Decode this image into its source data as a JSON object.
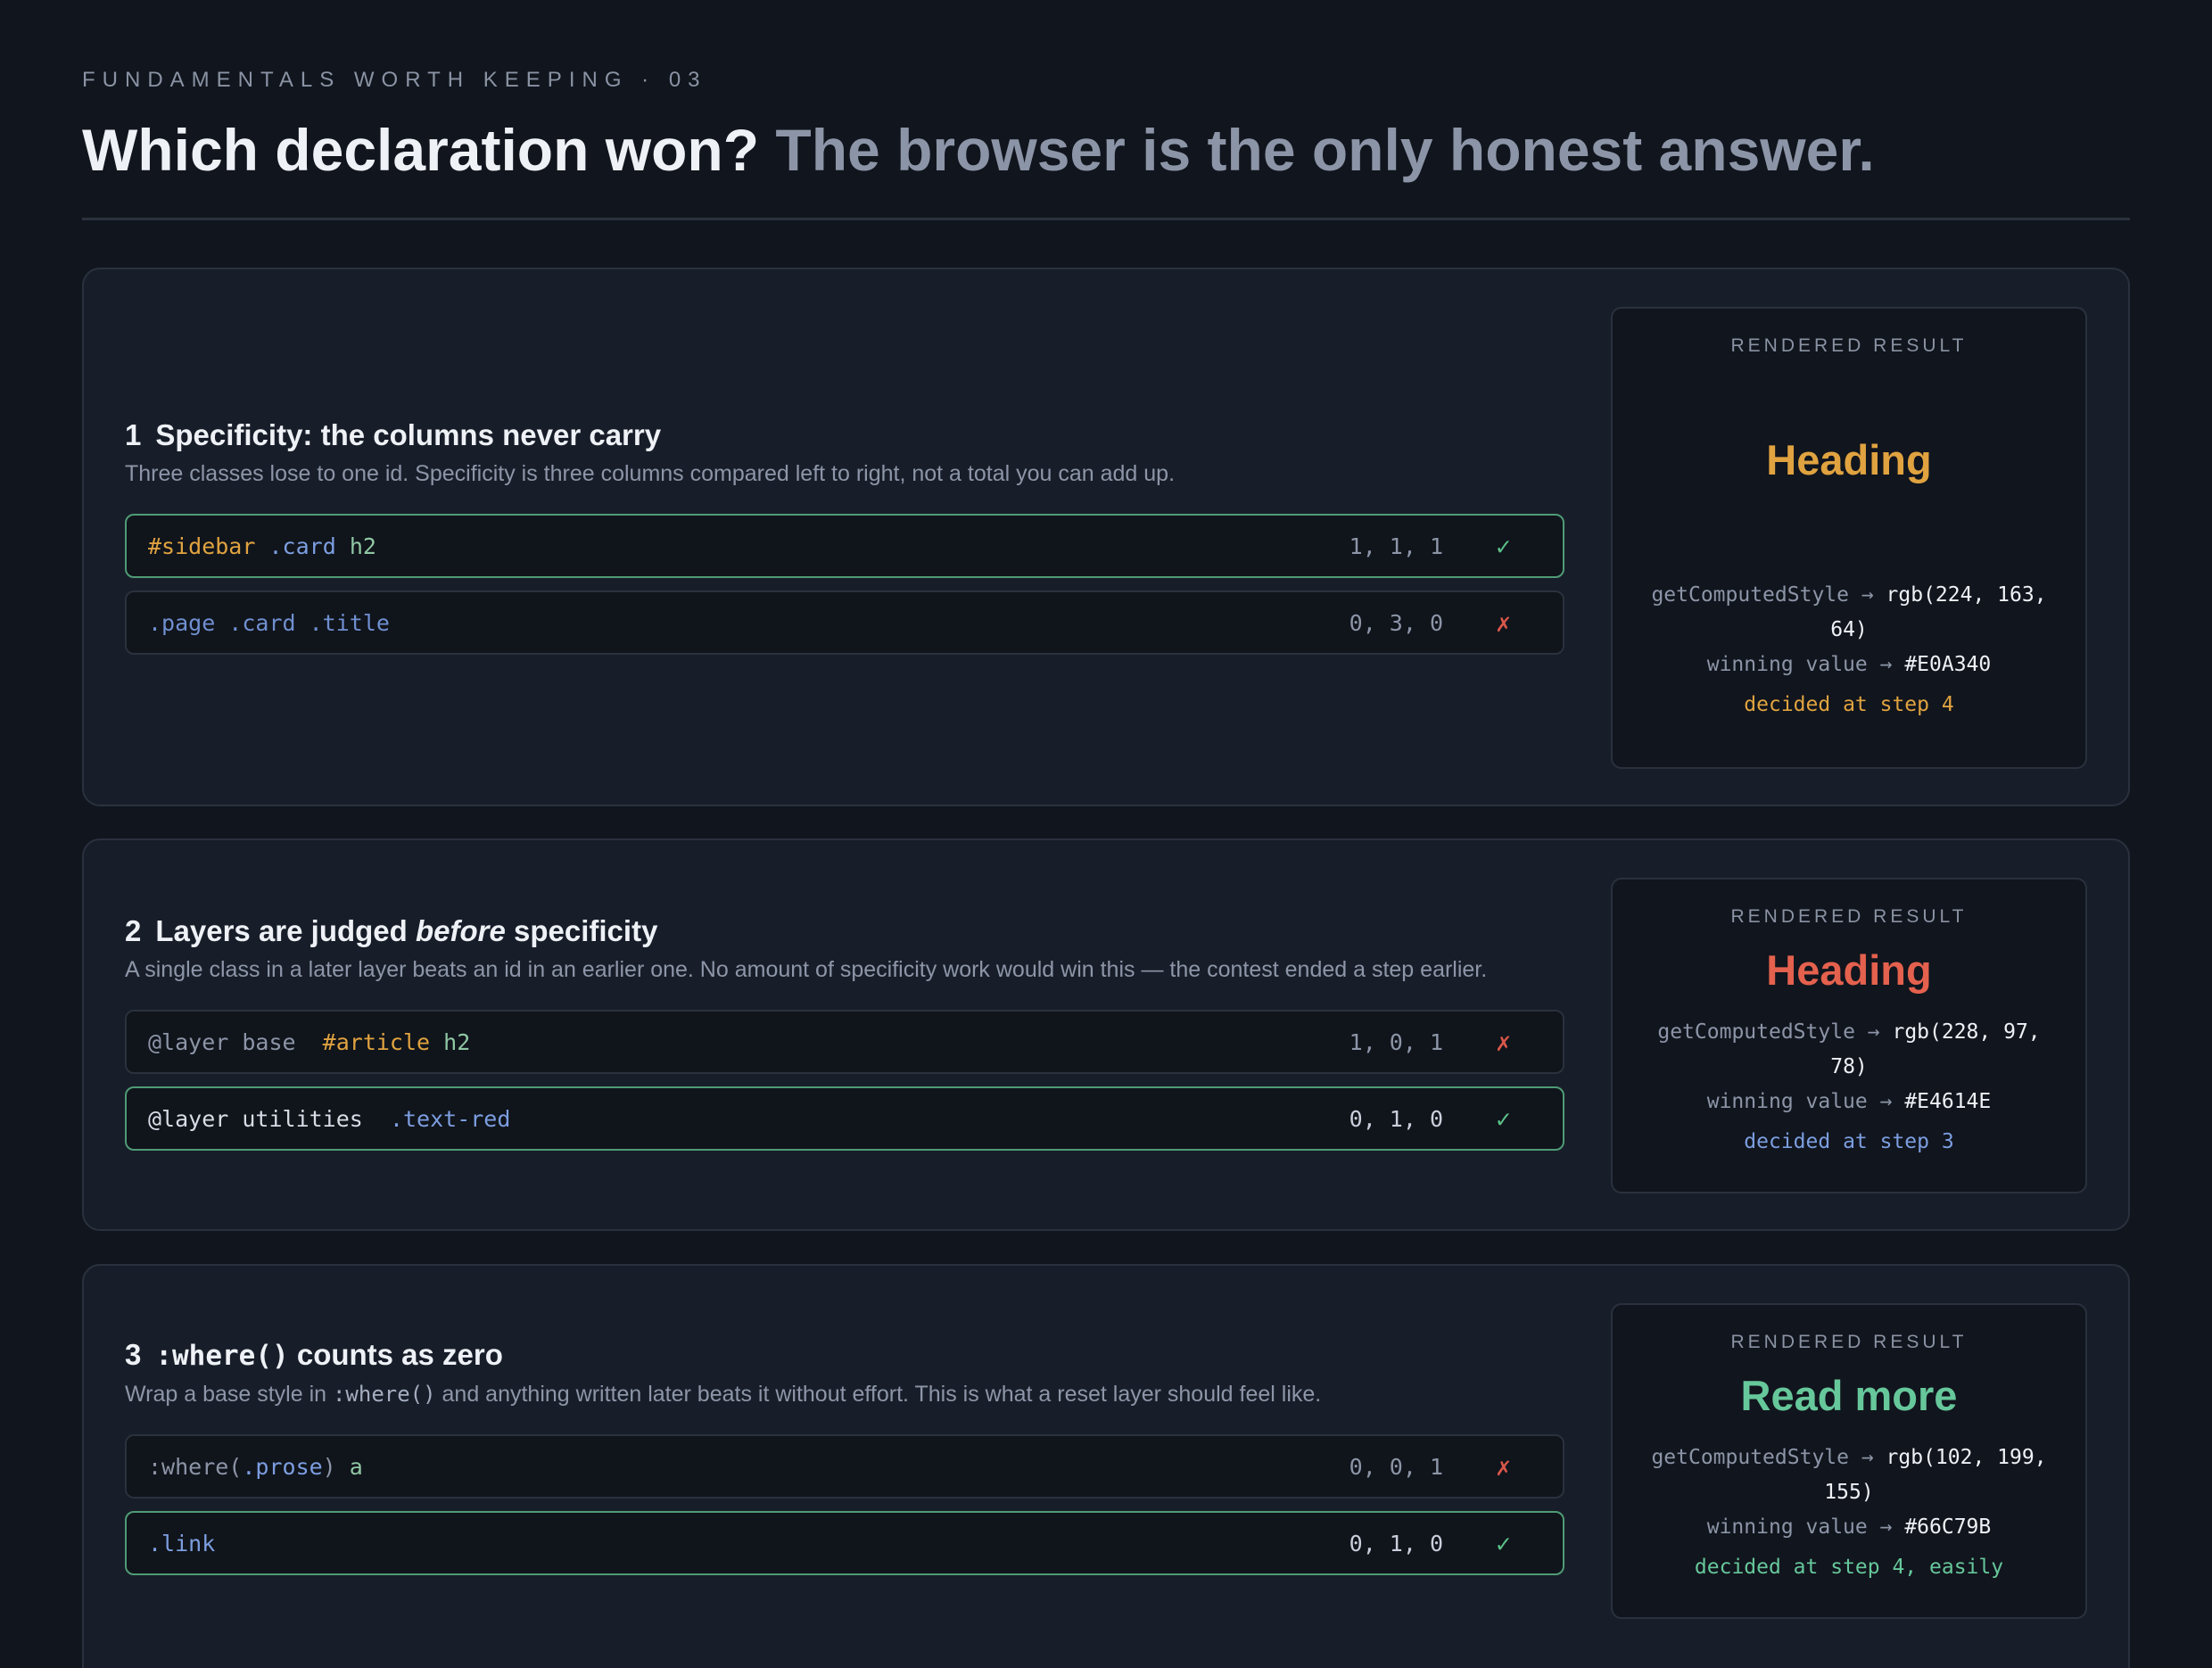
{
  "header": {
    "eyebrow": "FUNDAMENTALS WORTH KEEPING · 03",
    "title_strong": "Which declaration won?",
    "title_soft": "The browser is the only honest answer."
  },
  "colors": {
    "accent_amber": "#E0A340",
    "accent_red": "#E4614E",
    "accent_green": "#66C79B",
    "accent_blue": "#7C9EE0",
    "winner_border": "#4F9B76"
  },
  "sections": [
    {
      "number": "1",
      "title": "Specificity: the columns never carry",
      "description": "Three classes lose to one id. Specificity is three columns compared left to right, not a total you can add up.",
      "rules": [
        {
          "selector": [
            "#sidebar",
            " ",
            ".card",
            " ",
            "h2"
          ],
          "specificity": "1, 1, 1",
          "mark": "✓",
          "winner": true
        },
        {
          "selector": [
            ".page .card .title"
          ],
          "specificity": "0, 3, 0",
          "mark": "✗",
          "winner": false
        }
      ],
      "result": {
        "label": "RENDERED RESULT",
        "heading": "Heading",
        "computed_label": "getComputedStyle →",
        "computed_value": "rgb(224, 163, 64)",
        "winning_label": "winning value →",
        "winning_value": "#E0A340",
        "step": "decided at step 4"
      }
    },
    {
      "number": "2",
      "title_pre": "Layers are judged ",
      "title_em": "before",
      "title_post": " specificity",
      "description": "A single class in a later layer beats an id in an earlier one. No amount of specificity work would win this — the contest ended a step earlier.",
      "rules": [
        {
          "selector": [
            "@layer base  ",
            "#article",
            " ",
            "h2"
          ],
          "specificity": "1, 0, 1",
          "mark": "✗",
          "winner": false
        },
        {
          "selector": [
            "@layer utilities  ",
            ".text-red"
          ],
          "specificity": "0, 1, 0",
          "mark": "✓",
          "winner": true
        }
      ],
      "result": {
        "label": "RENDERED RESULT",
        "heading": "Heading",
        "computed_label": "getComputedStyle →",
        "computed_value": "rgb(228, 97, 78)",
        "winning_label": "winning value →",
        "winning_value": "#E4614E",
        "step": "decided at step 3"
      }
    },
    {
      "number": "3",
      "title_code": ":where()",
      "title_post": " counts as zero",
      "description_pre": "Wrap a base style in ",
      "description_code": ":where()",
      "description_post": " and anything written later beats it without effort. This is what a reset layer should feel like.",
      "rules": [
        {
          "selector": [
            ":where(",
            ".prose",
            ")",
            " ",
            "a"
          ],
          "specificity": "0, 0, 1",
          "mark": "✗",
          "winner": false
        },
        {
          "selector": [
            ".link"
          ],
          "specificity": "0, 1, 0",
          "mark": "✓",
          "winner": true
        }
      ],
      "result": {
        "label": "RENDERED RESULT",
        "heading": "Read more",
        "computed_label": "getComputedStyle →",
        "computed_value": "rgb(102, 199, 155)",
        "winning_label": "winning value →",
        "winning_value": "#66C79B",
        "step": "decided at step 4, easily"
      }
    }
  ]
}
